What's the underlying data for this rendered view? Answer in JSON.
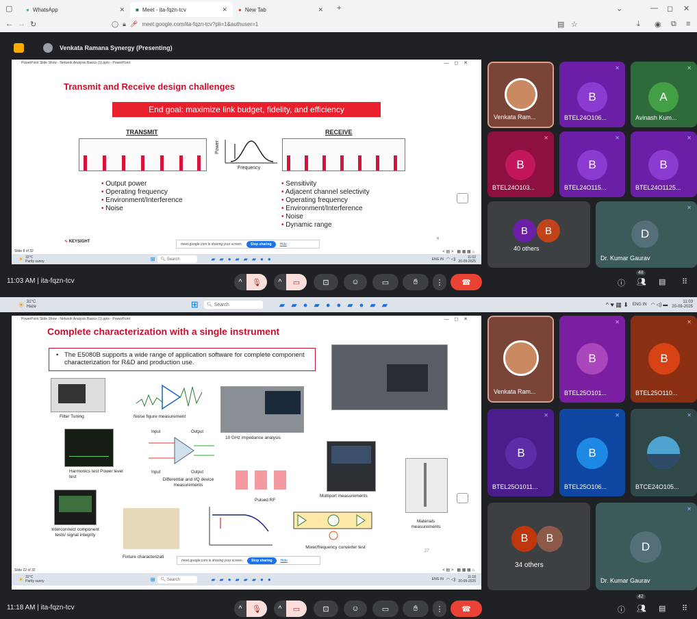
{
  "browser": {
    "tabs": [
      {
        "label": "WhatsApp"
      },
      {
        "label": "Meet - ita-fqzn-tcv"
      },
      {
        "label": "New Tab"
      }
    ],
    "new_tab": "+",
    "url": "meet.google.com/ita-fqzn-tcv?pli=1&authuser=1"
  },
  "meet": {
    "presenter": "Venkata Ramana Synergy (Presenting)"
  },
  "session1": {
    "ppt_title": "PowerPoint Slide Show - Network Analysis Basics (1).pptx - PowerPoint",
    "slide_title": "Transmit and Receive design challenges",
    "goal": "End goal: maximize link budget, fidelity, and efficiency",
    "transmit_label": "TRANSMIT",
    "receive_label": "RECEIVE",
    "power_label": "Power",
    "frequency_label": "Frequency",
    "transmit_items": [
      "Output power",
      "Operating frequency",
      "Environment/Interference",
      "Noise"
    ],
    "receive_items": [
      "Sensitivity",
      "Adjacent channel selectivity",
      "Operating frequency",
      "Environment/Interference",
      "Noise",
      "Dynamic range"
    ],
    "logo": "KEYSIGHT",
    "slide_count": "Slide 8 of 32",
    "weather_temp": "32°C",
    "weather_desc": "Partly sunny",
    "search": "Search",
    "lang": "ENG IN",
    "time": "11:02",
    "date": "20-09-2025",
    "meet_time": "11:03 AM | ita-fqzn-tcv",
    "participants": [
      {
        "name": "Venkata Ram...",
        "initial": "",
        "color": "#7a4438"
      },
      {
        "name": "BTEL24O106...",
        "initial": "B",
        "color": "#6a1fa6"
      },
      {
        "name": "Avinash Kum...",
        "initial": "A",
        "color": "#2e6a3a"
      },
      {
        "name": "BTEL24O103...",
        "initial": "B",
        "color": "#8e1040"
      },
      {
        "name": "BTEL24O115...",
        "initial": "B",
        "color": "#6a1fa6"
      },
      {
        "name": "BTEL24O1125...",
        "initial": "B",
        "color": "#6a1fa6"
      }
    ],
    "others_label": "40 others",
    "dr_name": "Dr. Kumar Gaurav",
    "dr_initial": "D",
    "people_count": "48"
  },
  "taskbar_mid": {
    "temp": "31°C",
    "desc": "Haze",
    "search": "Search",
    "lang": "ENG IN",
    "time": "11:03",
    "date": "20-09-2025"
  },
  "session2": {
    "ppt_title": "PowerPoint Slide Show - Network Analysis Basics (1).pptx - PowerPoint",
    "slide_title": "Complete characterization with a single instrument",
    "bullet": "The E5080B supports a wide range of application software for complete component characterization for R&D and production use.",
    "thumbs": {
      "filter": "Filter Tuning",
      "noise": "Noise figure measurement",
      "impedance": "10 GHz impedance analysis",
      "harmonics": "Harmonics test Power level test",
      "diff": "Differential and I/Q device measurements",
      "pulsed": "Pulsed RF",
      "multiport": "Multiport measurements",
      "materials": "Materials measurements",
      "interconnect": "Interconnect component tests/ signal integrity",
      "fixture": "Fixture characterizati",
      "mixer": "Mixer/frequency converter test",
      "input": "Input",
      "output": "Output"
    },
    "page_num": "27",
    "slide_count": "Slide 22 of 32",
    "weather_temp": "32°C",
    "weather_desc": "Partly sunny",
    "search": "Search",
    "lang": "ENG IN",
    "time": "11:18",
    "date": "20-09-2025",
    "meet_time": "11:18 AM | ita-fqzn-tcv",
    "participants": [
      {
        "name": "Venkata Ram...",
        "initial": "",
        "color": "#7a4438"
      },
      {
        "name": "BTEL25O101...",
        "initial": "B",
        "color": "#9c27b0"
      },
      {
        "name": "BTEL25O110...",
        "initial": "B",
        "color": "#c0431a"
      },
      {
        "name": "BTEL25O1011...",
        "initial": "B",
        "color": "#5b1fa6"
      },
      {
        "name": "BTEL25O106...",
        "initial": "B",
        "color": "#1a73e8"
      },
      {
        "name": "BTCE24O105...",
        "initial": "",
        "color": "#304848"
      }
    ],
    "others_label": "34 others",
    "dr_name": "Dr. Kumar Gaurav",
    "dr_initial": "D",
    "people_count": "42"
  },
  "sharing": {
    "text": "meet.google.com is sharing your screen.",
    "stop": "Stop sharing",
    "hide": "Hide"
  }
}
